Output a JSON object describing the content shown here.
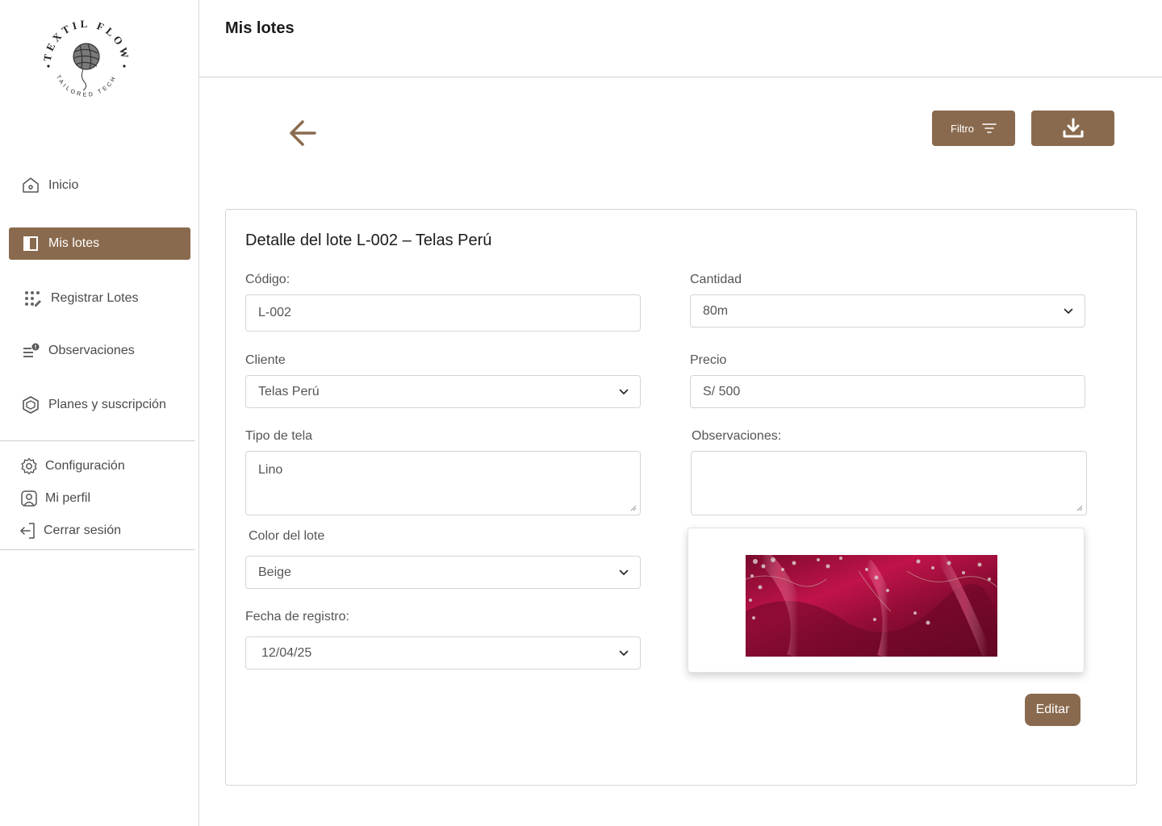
{
  "brand": {
    "name_top": "TEXTIL FLOW",
    "name_bottom": "TAILORED TECH"
  },
  "sidebar": {
    "items": [
      {
        "label": "Inicio",
        "icon": "home-icon"
      },
      {
        "label": "Mis lotes",
        "icon": "panel-icon",
        "active": true
      },
      {
        "label": "Registrar Lotes",
        "icon": "grid-edit-icon"
      },
      {
        "label": "Observaciones",
        "icon": "list-alert-icon"
      },
      {
        "label": "Planes y suscripción",
        "icon": "box-icon"
      }
    ],
    "bottom": [
      {
        "label": "Configuración",
        "icon": "gear-icon"
      },
      {
        "label": "Mi perfil",
        "icon": "user-icon"
      },
      {
        "label": "Cerrar sesión",
        "icon": "logout-icon"
      }
    ]
  },
  "header": {
    "title": "Mis lotes"
  },
  "toolbar": {
    "filter_label": "Filtro"
  },
  "detail": {
    "title": "Detalle del lote L-002 – Telas Perú",
    "codigo": {
      "label": "Código:",
      "value": "L-002"
    },
    "cantidad": {
      "label": "Cantidad",
      "value": "80m"
    },
    "cliente": {
      "label": "Cliente",
      "value": "Telas Perú"
    },
    "precio": {
      "label": "Precio",
      "value": "S/ 500"
    },
    "tipo_tela": {
      "label": "Tipo de tela",
      "value": "Lino"
    },
    "observaciones": {
      "label": "Observaciones:",
      "value": ""
    },
    "color": {
      "label": "Color del lote",
      "value": "Beige"
    },
    "fecha": {
      "label": "Fecha de registro:",
      "value": "12/04/25"
    },
    "edit_label": "Editar"
  },
  "colors": {
    "accent": "#8a6a4e",
    "border": "#d4d4d4",
    "fabric": "#a8123f"
  }
}
